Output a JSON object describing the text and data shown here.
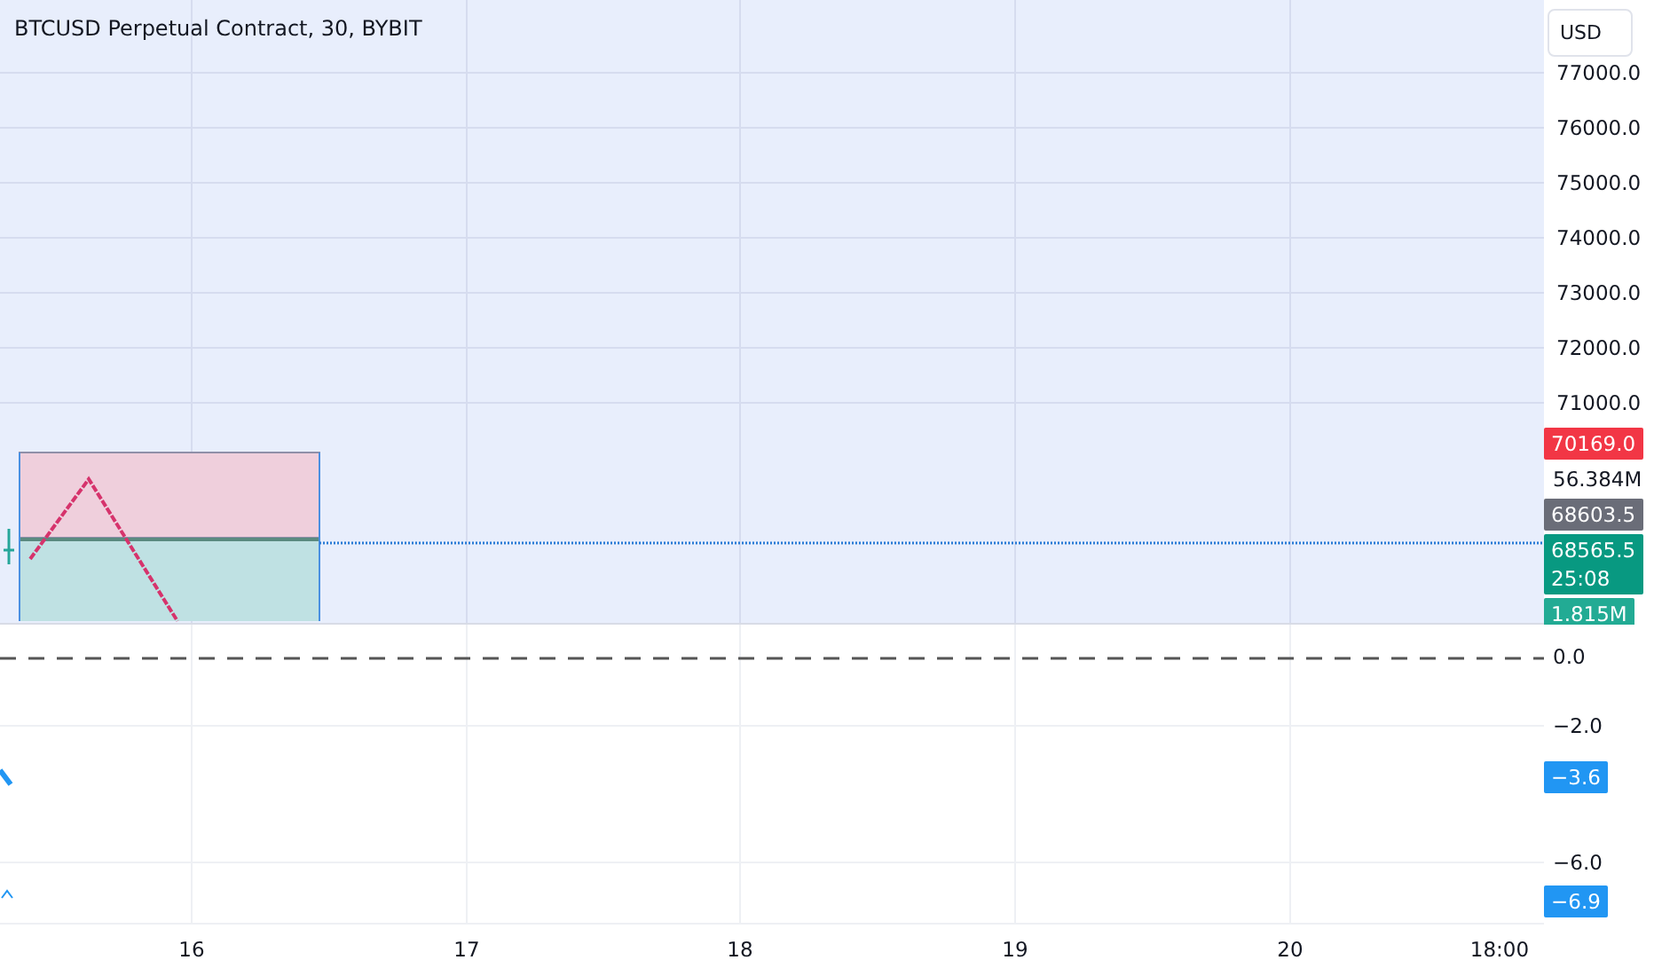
{
  "chart": {
    "title": "BTCUSD Perpetual Contract, 30, BYBIT"
  },
  "currency_button": {
    "label": "USD"
  },
  "price_axis": {
    "ticks": [
      "77000.0",
      "76000.0",
      "75000.0",
      "74000.0",
      "73000.0",
      "72000.0",
      "71000.0"
    ],
    "labels": [
      {
        "kind": "badge",
        "text": "70169.0",
        "color": "#f23645"
      },
      {
        "kind": "plain",
        "text": "56.384M"
      },
      {
        "kind": "badge",
        "text": "68603.5",
        "color": "#6a6d78"
      },
      {
        "kind": "badge",
        "text": "68565.5",
        "subtext": "25:08",
        "color": "#089981"
      },
      {
        "kind": "badge",
        "text": "1.815M",
        "color": "#22ab94"
      }
    ]
  },
  "indicator_axis": {
    "labels": [
      {
        "kind": "plain",
        "text": "0.0"
      },
      {
        "kind": "plain",
        "text": "−2.0"
      },
      {
        "kind": "badge",
        "text": "−3.6",
        "color": "#2196f3"
      },
      {
        "kind": "plain",
        "text": "−6.0"
      },
      {
        "kind": "badge",
        "text": "−6.9",
        "color": "#2196f3"
      }
    ]
  },
  "time_axis": {
    "ticks": [
      "16",
      "17",
      "18",
      "19",
      "20",
      "18:00"
    ]
  }
}
